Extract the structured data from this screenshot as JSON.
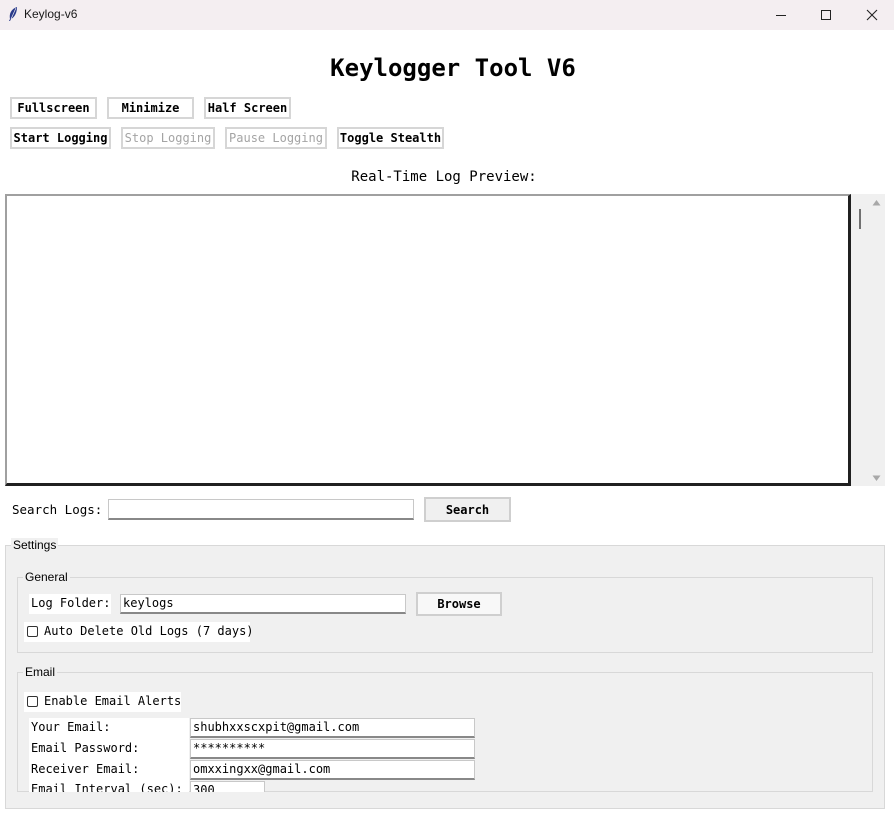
{
  "window": {
    "title": "Keylog-v6",
    "controls": [
      "minimize",
      "maximize",
      "close"
    ]
  },
  "header": {
    "title": "Keylogger Tool V6"
  },
  "window_buttons": {
    "fullscreen": "Fullscreen",
    "minimize": "Minimize",
    "half_screen": "Half Screen"
  },
  "logging_buttons": {
    "start": "Start Logging",
    "stop": "Stop Logging",
    "pause": "Pause Logging",
    "stealth": "Toggle Stealth"
  },
  "preview": {
    "label": "Real-Time Log Preview:",
    "content": ""
  },
  "search": {
    "label": "Search Logs:",
    "value": "",
    "button": "Search"
  },
  "settings": {
    "title": "Settings",
    "general": {
      "title": "General",
      "log_folder_label": "Log Folder:",
      "log_folder_value": "keylogs",
      "browse_button": "Browse",
      "auto_delete_label": "Auto Delete Old Logs (7 days)",
      "auto_delete_checked": false
    },
    "email": {
      "title": "Email",
      "enable_label": "Enable Email Alerts",
      "enable_checked": false,
      "your_email_label": "Your Email:",
      "your_email_value": "shubhxxscxpit@gmail.com",
      "password_label": "Email Password:",
      "password_value": "**********",
      "receiver_label": "Receiver Email:",
      "receiver_value": "omxxingxx@gmail.com",
      "interval_label": "Email Interval (sec):",
      "interval_value": "300"
    }
  },
  "colors": {
    "titlebar": "#f4eef1",
    "panel": "#f0f0f0",
    "disabled_text": "#a4a4a4"
  }
}
